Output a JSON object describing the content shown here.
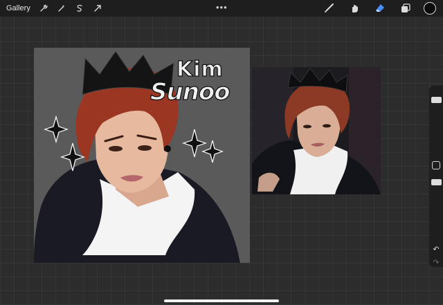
{
  "topbar": {
    "gallery_label": "Gallery",
    "left_tools": [
      "wrench-icon",
      "magic-wand-icon",
      "selection-icon",
      "transform-arrow-icon"
    ],
    "more_label": "•••",
    "right_tools": [
      "brush-icon",
      "smudge-icon",
      "eraser-icon",
      "layers-icon"
    ],
    "active_tool": "eraser",
    "current_color": "#0c0c0c"
  },
  "artwork": {
    "first_name": "Kim",
    "last_name": "Sunoo"
  },
  "sidebar": {
    "undo_label": "↶",
    "redo_label": "↷"
  },
  "colors": {
    "active_tool": "#4a8fff",
    "toolbar_bg": "#1e1e1e",
    "canvas_bg": "#5a5a5a"
  }
}
